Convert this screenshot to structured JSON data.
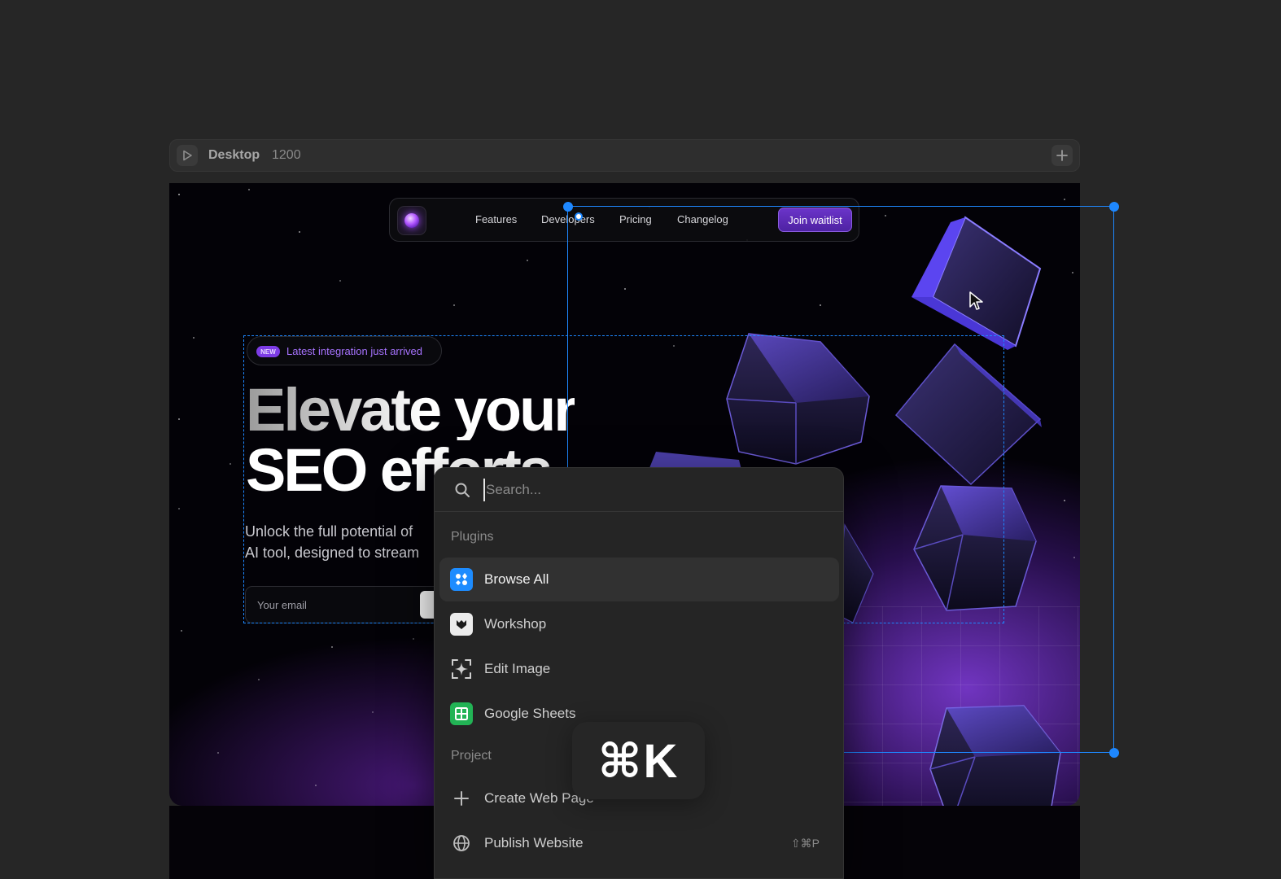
{
  "frame": {
    "title": "Desktop",
    "width_label": "1200"
  },
  "site": {
    "nav": {
      "links": [
        "Features",
        "Developers",
        "Pricing",
        "Changelog"
      ],
      "cta": "Join waitlist"
    },
    "badge": {
      "tag": "NEW",
      "text": "Latest integration just arrived"
    },
    "hero": {
      "line1": "Elevate your",
      "line2": "SEO efforts",
      "sub_line1": "Unlock the full potential of",
      "sub_line2": "AI tool, designed to stream"
    },
    "email_placeholder": "Your email"
  },
  "palette": {
    "search_placeholder": "Search...",
    "sections": {
      "plugins": "Plugins",
      "project": "Project"
    },
    "plugins": [
      {
        "label": "Browse All",
        "icon": "grid-icon",
        "color": "#1d8cff"
      },
      {
        "label": "Workshop",
        "icon": "workshop-icon",
        "color": "#ececec"
      },
      {
        "label": "Edit Image",
        "icon": "sparkle-icon",
        "color": "#3a3a3a"
      },
      {
        "label": "Google Sheets",
        "icon": "sheets-icon",
        "color": "#22b355"
      }
    ],
    "project": [
      {
        "label": "Create Web Page",
        "icon": "plus-icon"
      },
      {
        "label": "Publish Website",
        "icon": "globe-icon",
        "shortcut": "⇧⌘P"
      }
    ]
  },
  "shortcut_overlay": "⌘K",
  "colors": {
    "selection": "#1e88ff",
    "accent": "#7d3ce6",
    "palette_bg": "#252525"
  }
}
